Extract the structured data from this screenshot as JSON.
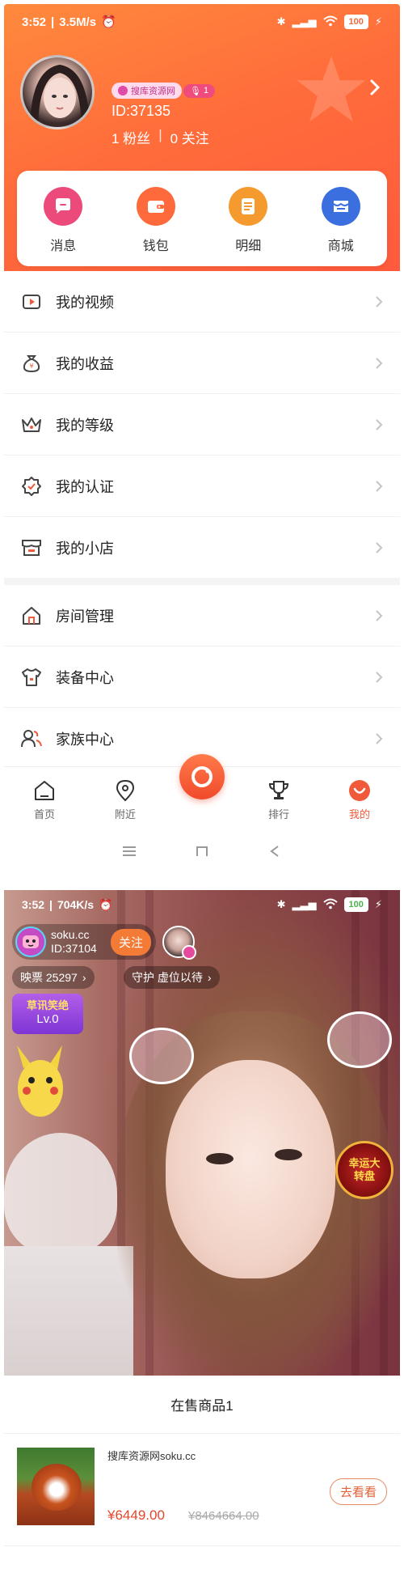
{
  "screen1": {
    "status": {
      "time": "3:52",
      "speed": "3.5M/s",
      "battery": "100"
    },
    "profile": {
      "source_badge": "搜库资源网",
      "level_badge": "1",
      "id": "ID:37135",
      "fans": "1 粉丝",
      "following": "0 关注",
      "separator": "|"
    },
    "quick_actions": [
      {
        "label": "消息",
        "icon": "message-icon",
        "color": "#ec4a7a"
      },
      {
        "label": "钱包",
        "icon": "wallet-icon",
        "color": "#ff6a3d"
      },
      {
        "label": "明细",
        "icon": "detail-list-icon",
        "color": "#f59a2e"
      },
      {
        "label": "商城",
        "icon": "mall-icon",
        "color": "#3b6fe0"
      }
    ],
    "menu_group1": [
      {
        "label": "我的视频",
        "icon": "video-icon"
      },
      {
        "label": "我的收益",
        "icon": "money-bag-icon"
      },
      {
        "label": "我的等级",
        "icon": "crown-icon"
      },
      {
        "label": "我的认证",
        "icon": "certified-icon"
      },
      {
        "label": "我的小店",
        "icon": "shop-icon"
      }
    ],
    "menu_group2": [
      {
        "label": "房间管理",
        "icon": "house-icon"
      },
      {
        "label": "装备中心",
        "icon": "shirt-icon"
      },
      {
        "label": "家族中心",
        "icon": "family-icon"
      }
    ],
    "tabbar": [
      {
        "label": "首页",
        "icon": "home-icon"
      },
      {
        "label": "附近",
        "icon": "location-icon"
      },
      {
        "label": "排行",
        "icon": "trophy-icon"
      },
      {
        "label": "我的",
        "icon": "profile-icon"
      }
    ],
    "accent": "#f05a3a"
  },
  "screen2": {
    "status": {
      "time": "3:52",
      "speed": "704K/s",
      "battery": "100"
    },
    "host": {
      "name": "soku.cc",
      "id": "ID:37104",
      "follow_label": "关注"
    },
    "tickets": "映票 25297",
    "guard": "守护 虚位以待",
    "level": {
      "title": "草讯笑绝",
      "value": "Lv.0"
    },
    "wheel": {
      "text": "幸运大转盘"
    },
    "shop": {
      "title": "在售商品1",
      "product": {
        "name": "搜库资源网soku.cc",
        "price": "¥6449.00",
        "old_price": "¥8464664.00",
        "button": "去看看"
      }
    }
  }
}
